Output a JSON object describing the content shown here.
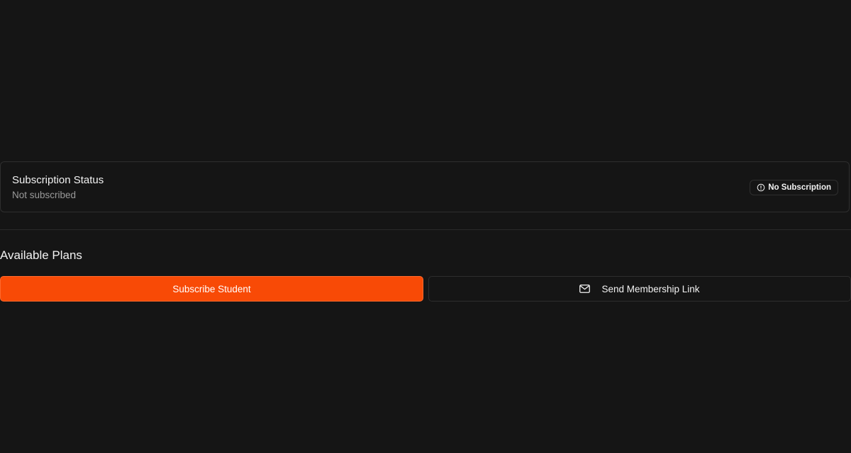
{
  "subscription": {
    "title": "Subscription Status",
    "status_text": "Not subscribed",
    "badge": {
      "label": "No Subscription",
      "icon": "info-circle-icon"
    }
  },
  "plans": {
    "heading": "Available Plans",
    "subscribe_button": "Subscribe Student",
    "send_link_button": "Send Membership Link",
    "send_link_icon": "mail-icon"
  },
  "colors": {
    "background": "#151515",
    "accent": "#f84a06",
    "border": "#2e2e2e",
    "muted_text": "#9a9a9a"
  }
}
